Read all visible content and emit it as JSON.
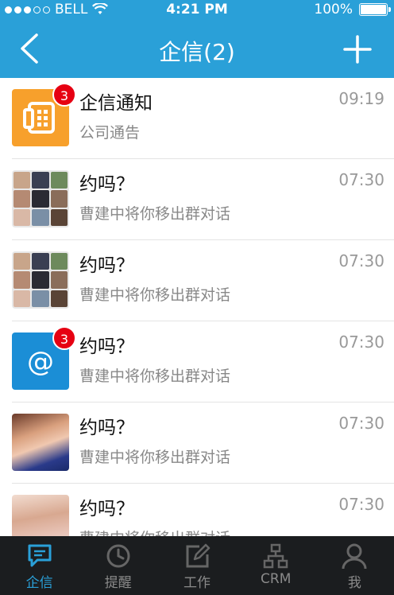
{
  "status_bar": {
    "carrier": "BELL",
    "time": "4:21 PM",
    "battery": "100%",
    "signal_bars_filled": 3,
    "signal_bars_total": 5
  },
  "nav": {
    "title": "企信(2)",
    "back_icon": "chevron-left-icon",
    "add_icon": "plus-icon"
  },
  "conversations": [
    {
      "title": "企信通知",
      "subtitle": "公司通告",
      "time": "09:19",
      "badge": "3",
      "avatar": "notice-app-icon",
      "avatar_color": "#f7a02c"
    },
    {
      "title": "约吗？",
      "subtitle": "曹建中将你移出群对话",
      "time": "07:30",
      "avatar": "group-avatar-grid"
    },
    {
      "title": "约吗？",
      "subtitle": "曹建中将你移出群对话",
      "time": "07:30",
      "avatar": "group-avatar-grid"
    },
    {
      "title": "约吗？",
      "subtitle": "曹建中将你移出群对话",
      "time": "07:30",
      "badge": "3",
      "avatar": "at-icon",
      "avatar_color": "#1b8ed6"
    },
    {
      "title": "约吗？",
      "subtitle": "曹建中将你移出群对话",
      "time": "07:30",
      "avatar": "photo-avatar"
    },
    {
      "title": "约吗？",
      "subtitle": "曹建中将你移出群对话",
      "time": "07:30",
      "avatar": "photo-avatar"
    }
  ],
  "tabs": [
    {
      "label": "企信",
      "icon": "chat-bubble-icon",
      "active": true
    },
    {
      "label": "提醒",
      "icon": "clock-icon",
      "active": false
    },
    {
      "label": "工作",
      "icon": "edit-icon",
      "active": false
    },
    {
      "label": "CRM",
      "icon": "org-chart-icon",
      "active": false
    },
    {
      "label": "我",
      "icon": "person-icon",
      "active": false
    }
  ],
  "colors": {
    "accent": "#2aa0d8",
    "badge": "#e60012",
    "tabbar_bg": "#1b1d1f"
  }
}
